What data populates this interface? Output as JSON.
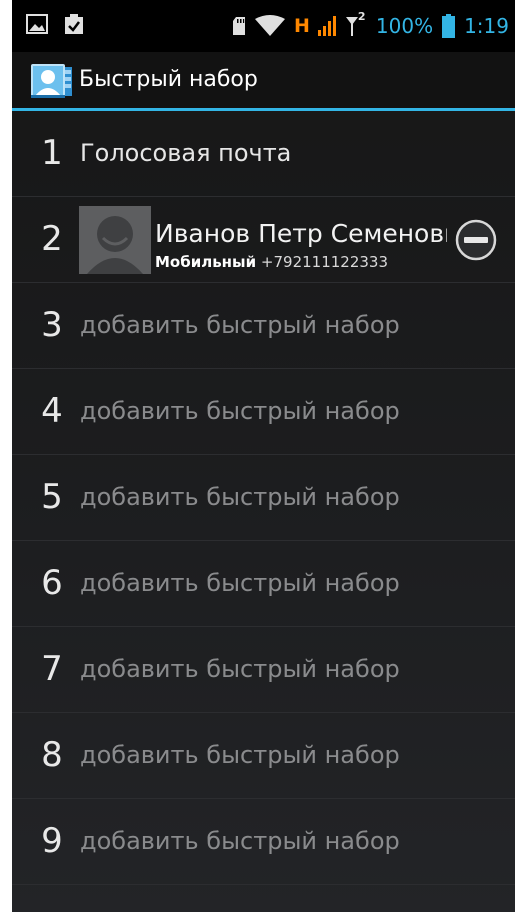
{
  "status_bar": {
    "network_label": "H",
    "roaming_label": "2",
    "battery_percent": "100%",
    "time": "1:19",
    "accent_color": "#33b5e5",
    "network_color": "#ff8800",
    "icons": [
      "image-icon",
      "clipboard-check-icon",
      "sd-card-icon",
      "wifi-icon",
      "signal-icon",
      "roaming-antenna-icon",
      "battery-icon"
    ]
  },
  "action_bar": {
    "title": "Быстрый набор",
    "app_icon": "contacts-app-icon"
  },
  "speed_dial": {
    "voicemail": {
      "number": "1",
      "label": "Голосовая почта"
    },
    "contact": {
      "number": "2",
      "name": "Иванов Петр Семенович",
      "phone_type": "Мобильный",
      "phone": "+792111122333",
      "avatar_icon": "default-avatar-icon",
      "remove_icon": "remove-circle-icon"
    },
    "empty_slots": [
      {
        "number": "3",
        "label": "добавить быстрый набор"
      },
      {
        "number": "4",
        "label": "добавить быстрый набор"
      },
      {
        "number": "5",
        "label": "добавить быстрый набор"
      },
      {
        "number": "6",
        "label": "добавить быстрый набор"
      },
      {
        "number": "7",
        "label": "добавить быстрый набор"
      },
      {
        "number": "8",
        "label": "добавить быстрый набор"
      },
      {
        "number": "9",
        "label": "добавить быстрый набор"
      }
    ]
  }
}
